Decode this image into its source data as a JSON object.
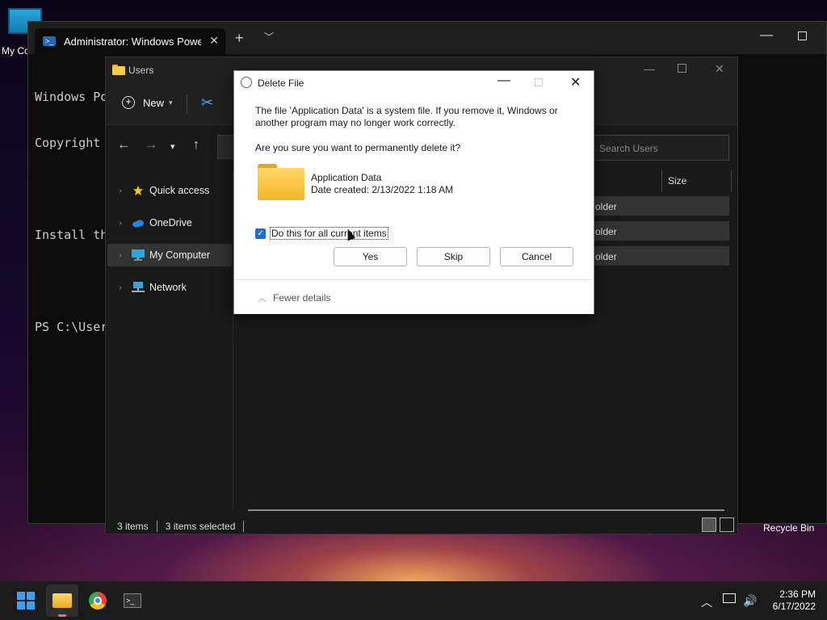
{
  "desktop": {
    "my_computer_label": "My Co",
    "recycle_bin_label": "Recycle Bin"
  },
  "terminal": {
    "tab_title": "Administrator: Windows PowerS",
    "lines": [
      "Windows Po",
      "Copyright",
      "",
      "Install th",
      "",
      "PS C:\\User"
    ]
  },
  "explorer": {
    "title": "Users",
    "new_label": "New",
    "search_placeholder": "Search Users",
    "nav_items": [
      {
        "label": "Quick access",
        "icon": "star-icon"
      },
      {
        "label": "OneDrive",
        "icon": "cloud-icon"
      },
      {
        "label": "My Computer",
        "icon": "monitor-icon"
      },
      {
        "label": "Network",
        "icon": "network-icon"
      }
    ],
    "column_size": "Size",
    "rows": [
      "older",
      "older",
      "older"
    ],
    "status_items": "3 items",
    "status_selected": "3 items selected"
  },
  "dialog": {
    "title": "Delete File",
    "message": "The file 'Application Data' is a system file. If you remove it, Windows or another program may no longer work correctly.",
    "question": "Are you sure you want to permanently delete it?",
    "file_name": "Application Data",
    "file_date": "Date created: 2/13/2022 1:18 AM",
    "checkbox_label": "Do this for all current items",
    "checkbox_checked": true,
    "yes": "Yes",
    "skip": "Skip",
    "cancel": "Cancel",
    "fewer_details": "Fewer details"
  },
  "taskbar": {
    "time": "2:36 PM",
    "date": "6/17/2022"
  },
  "colors": {
    "accent": "#1a6fd1",
    "folder": "#f2b628"
  }
}
